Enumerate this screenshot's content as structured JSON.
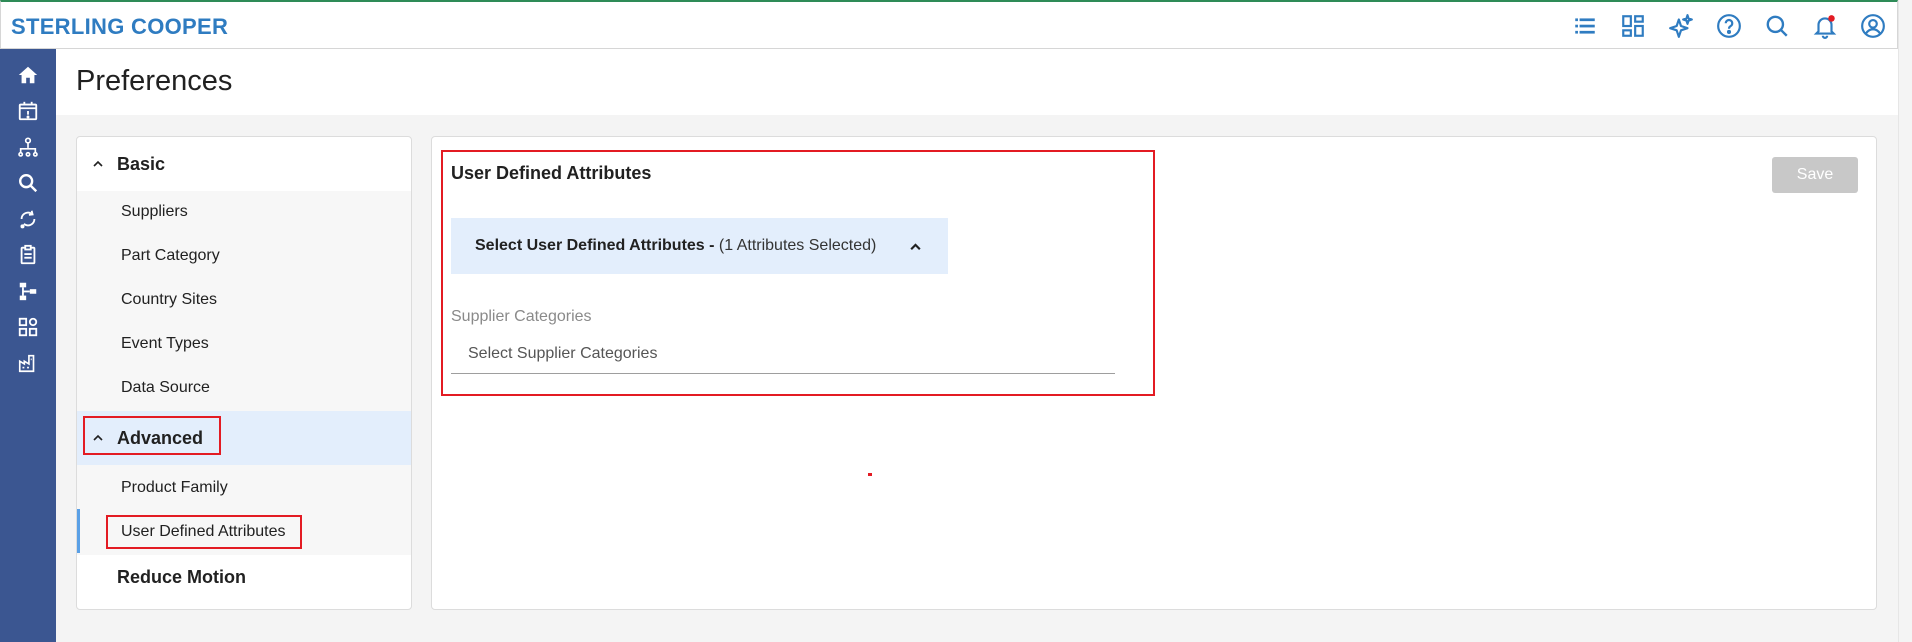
{
  "header": {
    "brand": "STERLING COOPER",
    "icons": [
      "list-icon",
      "dashboard-icon",
      "ai-sparkle-icon",
      "help-icon",
      "search-icon",
      "notifications-icon",
      "user-icon"
    ]
  },
  "rail": {
    "icons": [
      "home-icon",
      "calendar-alert-icon",
      "org-hierarchy-icon",
      "search-analytics-icon",
      "refresh-data-icon",
      "clipboard-icon",
      "workflow-icon",
      "apps-icon",
      "factory-icon"
    ]
  },
  "page": {
    "title": "Preferences"
  },
  "sidebar": {
    "basic": {
      "label": "Basic",
      "items": [
        "Suppliers",
        "Part Category",
        "Country Sites",
        "Event Types",
        "Data Source"
      ]
    },
    "advanced": {
      "label": "Advanced",
      "items": [
        "Product Family",
        "User Defined Attributes"
      ]
    },
    "reduce_motion": "Reduce Motion"
  },
  "main": {
    "title": "User Defined Attributes",
    "save_label": "Save",
    "accordion": {
      "title": "Select User Defined Attributes -",
      "count": "(1 Attributes Selected)"
    },
    "field": {
      "label": "Supplier Categories",
      "placeholder": "Select Supplier Categories"
    }
  },
  "colors": {
    "brand": "#2f7cc1",
    "rail": "#3b5691",
    "highlight": "#e3eefc",
    "annotation": "#e31b23"
  }
}
